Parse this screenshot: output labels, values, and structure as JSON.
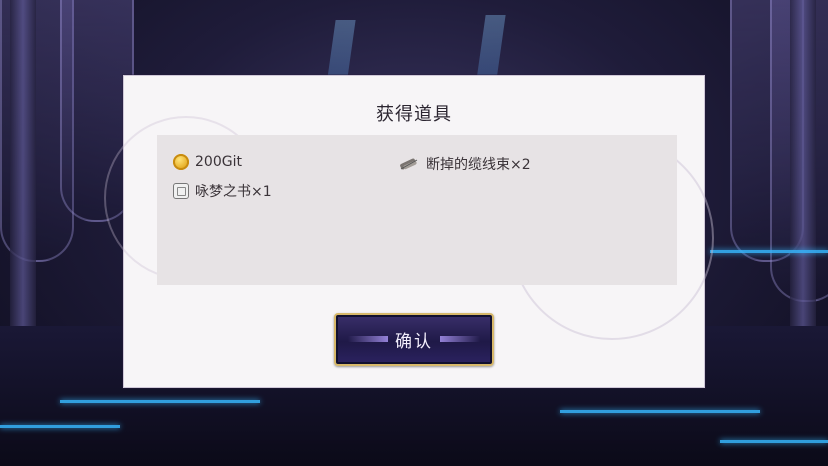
{
  "dialog": {
    "title": "获得道具",
    "rewards": [
      {
        "label": "200Git",
        "icon": "coin-icon"
      },
      {
        "label": "断掉的缆线束×2",
        "icon": "cable-icon"
      },
      {
        "label": "咏梦之书×1",
        "icon": "book-icon"
      }
    ],
    "confirm_label": "确认"
  },
  "colors": {
    "accent_gold": "#d7b86a",
    "button_bg": "#1f1947",
    "glow_blue": "#37b8ff"
  }
}
